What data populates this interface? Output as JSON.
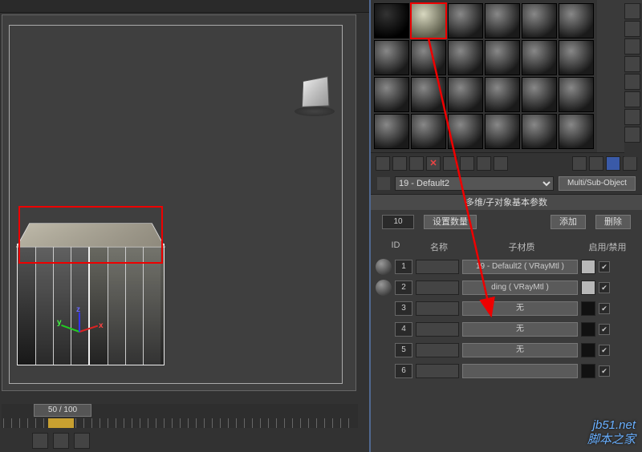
{
  "viewport": {
    "viewcube_label": "",
    "gizmo": {
      "x": "x",
      "y": "y",
      "z": "z"
    }
  },
  "timeline": {
    "slider_label": "50 / 100",
    "frame_start": 0,
    "frame_end": 100
  },
  "material_editor": {
    "selected_slot_index": 1,
    "name_dropdown": "19 - Default2",
    "type_button": "Multi/Sub-Object",
    "rollout_title": "多维/子对象基本参数",
    "num_subs": "10",
    "btn_set_count": "设置数量",
    "btn_add": "添加",
    "btn_delete": "删除",
    "headers": {
      "id": "ID",
      "name": "名称",
      "submtl": "子材质",
      "enable": "启用/禁用"
    },
    "rows": [
      {
        "id": "1",
        "name": "",
        "mat": "19 - Default2 ( VRayMtl )",
        "swatch": "#b8b8b8",
        "on": true,
        "has_thumb": true
      },
      {
        "id": "2",
        "name": "",
        "mat": "ding ( VRayMtl )",
        "swatch": "#b8b8b8",
        "on": true,
        "has_thumb": true
      },
      {
        "id": "3",
        "name": "",
        "mat": "无",
        "swatch": "#111111",
        "on": true,
        "has_thumb": false
      },
      {
        "id": "4",
        "name": "",
        "mat": "无",
        "swatch": "#111111",
        "on": true,
        "has_thumb": false
      },
      {
        "id": "5",
        "name": "",
        "mat": "无",
        "swatch": "#111111",
        "on": true,
        "has_thumb": false
      },
      {
        "id": "6",
        "name": "",
        "mat": "",
        "swatch": "#111111",
        "on": true,
        "has_thumb": false
      }
    ]
  },
  "icons": {
    "x_delete": "✕",
    "check": "✔"
  },
  "watermark": {
    "line1": "jb51.net",
    "line2": "脚本之家"
  },
  "annotations": {
    "red_box_viewport": "building-roof-selection",
    "red_box_slot": "material-slot-highlight",
    "arrow": "slot-to-submaterial-arrow"
  }
}
